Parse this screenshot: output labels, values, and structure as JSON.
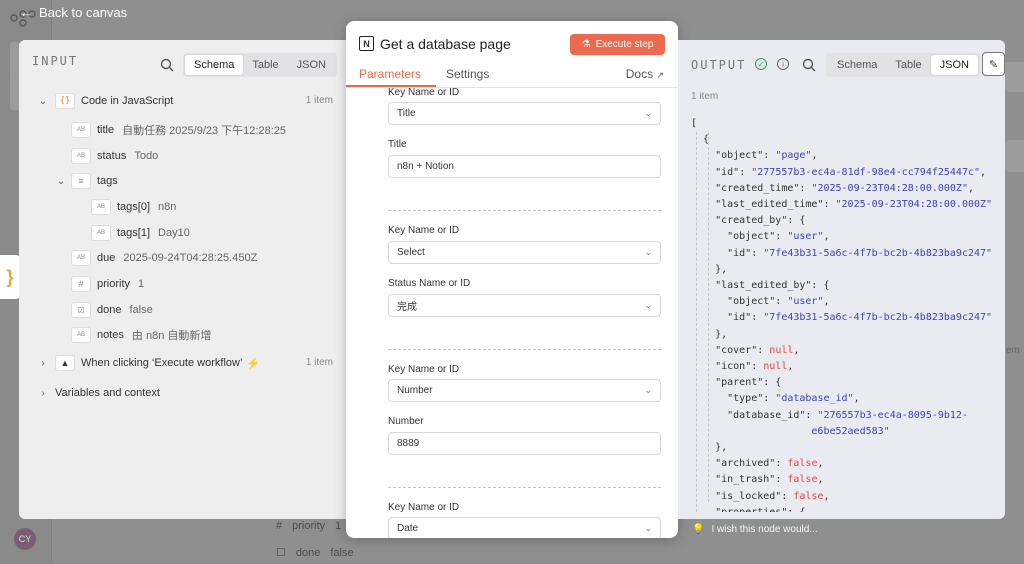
{
  "nav": {
    "back_label": "Back to canvas"
  },
  "bg": {
    "priority_key": "priority",
    "priority_val": "1",
    "done_key": "done",
    "done_val": "false",
    "right_frag": "em",
    "avatar_initials": "CY"
  },
  "input": {
    "header": "INPUT",
    "views": [
      "Schema",
      "Table",
      "JSON"
    ],
    "active_view": "Schema",
    "node_name": "Code in JavaScript",
    "node_count": "1 item",
    "fields": [
      {
        "type": "AB",
        "key": "title",
        "value": "自動任務 2025/9/23 下午12:28:25"
      },
      {
        "type": "AB",
        "key": "status",
        "value": "Todo"
      },
      {
        "type": "≡",
        "key": "tags",
        "value": ""
      },
      {
        "type": "AB",
        "key": "tags[0]",
        "value": "n8n"
      },
      {
        "type": "AB",
        "key": "tags[1]",
        "value": "Day10"
      },
      {
        "type": "AB",
        "key": "due",
        "value": "2025-09-24T04:28:25.450Z"
      },
      {
        "type": "#",
        "key": "priority",
        "value": "1"
      },
      {
        "type": "☑",
        "key": "done",
        "value": "false"
      },
      {
        "type": "AB",
        "key": "notes",
        "value": "由 n8n 自動新增"
      }
    ],
    "trigger_name": "When clicking ‘Execute workflow’",
    "trigger_count": "1 item",
    "vars_label": "Variables and context"
  },
  "modal": {
    "title": "Get a database page",
    "execute_label": "Execute step",
    "tabs": [
      "Parameters",
      "Settings"
    ],
    "docs_label": "Docs",
    "groups": [
      {
        "key_label": "Key Name or ID",
        "key_value": "Title",
        "field_label": "Title",
        "field_value": "n8n + Notion",
        "field_kind": "input"
      },
      {
        "key_label": "Key Name or ID",
        "key_value": "Select",
        "field_label": "Status Name or ID",
        "field_value": "完成",
        "field_kind": "select"
      },
      {
        "key_label": "Key Name or ID",
        "key_value": "Number",
        "field_label": "Number",
        "field_value": "8889",
        "field_kind": "input"
      },
      {
        "key_label": "Key Name or ID",
        "key_value": "Date"
      }
    ]
  },
  "output": {
    "header": "OUTPUT",
    "views": [
      "Schema",
      "Table",
      "JSON"
    ],
    "active_view": "JSON",
    "count": "1 item",
    "json_lines": [
      [
        [
          "p",
          "["
        ]
      ],
      [
        [
          "p",
          "  {"
        ]
      ],
      [
        [
          "p",
          "    "
        ],
        [
          "k",
          "\"object\""
        ],
        [
          "p",
          ": "
        ],
        [
          "s",
          "\"page\""
        ],
        [
          "p",
          ","
        ]
      ],
      [
        [
          "p",
          "    "
        ],
        [
          "k",
          "\"id\""
        ],
        [
          "p",
          ": "
        ],
        [
          "s",
          "\"277557b3-ec4a-81df-98e4-cc794f25447c\""
        ],
        [
          "p",
          ","
        ]
      ],
      [
        [
          "p",
          "    "
        ],
        [
          "k",
          "\"created_time\""
        ],
        [
          "p",
          ": "
        ],
        [
          "s",
          "\"2025-09-23T04:28:00.000Z\""
        ],
        [
          "p",
          ","
        ]
      ],
      [
        [
          "p",
          "    "
        ],
        [
          "k",
          "\"last_edited_time\""
        ],
        [
          "p",
          ": "
        ],
        [
          "s",
          "\"2025-09-23T04:28:00.000Z\""
        ],
        [
          "p",
          ","
        ]
      ],
      [
        [
          "p",
          "    "
        ],
        [
          "k",
          "\"created_by\""
        ],
        [
          "p",
          ": {"
        ]
      ],
      [
        [
          "p",
          "      "
        ],
        [
          "k",
          "\"object\""
        ],
        [
          "p",
          ": "
        ],
        [
          "s",
          "\"user\""
        ],
        [
          "p",
          ","
        ]
      ],
      [
        [
          "p",
          "      "
        ],
        [
          "k",
          "\"id\""
        ],
        [
          "p",
          ": "
        ],
        [
          "s",
          "\"7fe43b31-5a6c-4f7b-bc2b-4b823ba9c247\""
        ]
      ],
      [
        [
          "p",
          "    },"
        ]
      ],
      [
        [
          "p",
          "    "
        ],
        [
          "k",
          "\"last_edited_by\""
        ],
        [
          "p",
          ": {"
        ]
      ],
      [
        [
          "p",
          "      "
        ],
        [
          "k",
          "\"object\""
        ],
        [
          "p",
          ": "
        ],
        [
          "s",
          "\"user\""
        ],
        [
          "p",
          ","
        ]
      ],
      [
        [
          "p",
          "      "
        ],
        [
          "k",
          "\"id\""
        ],
        [
          "p",
          ": "
        ],
        [
          "s",
          "\"7fe43b31-5a6c-4f7b-bc2b-4b823ba9c247\""
        ]
      ],
      [
        [
          "p",
          "    },"
        ]
      ],
      [
        [
          "p",
          "    "
        ],
        [
          "k",
          "\"cover\""
        ],
        [
          "p",
          ": "
        ],
        [
          "n",
          "null"
        ],
        [
          "p",
          ","
        ]
      ],
      [
        [
          "p",
          "    "
        ],
        [
          "k",
          "\"icon\""
        ],
        [
          "p",
          ": "
        ],
        [
          "n",
          "null"
        ],
        [
          "p",
          ","
        ]
      ],
      [
        [
          "p",
          "    "
        ],
        [
          "k",
          "\"parent\""
        ],
        [
          "p",
          ": {"
        ]
      ],
      [
        [
          "p",
          "      "
        ],
        [
          "k",
          "\"type\""
        ],
        [
          "p",
          ": "
        ],
        [
          "s",
          "\"database_id\""
        ],
        [
          "p",
          ","
        ]
      ],
      [
        [
          "p",
          "      "
        ],
        [
          "k",
          "\"database_id\""
        ],
        [
          "p",
          ": "
        ],
        [
          "s",
          "\"276557b3-ec4a-8095-9b12-"
        ]
      ],
      [
        [
          "s",
          "                    e6be52aed583\""
        ]
      ],
      [
        [
          "p",
          "    },"
        ]
      ],
      [
        [
          "p",
          "    "
        ],
        [
          "k",
          "\"archived\""
        ],
        [
          "p",
          ": "
        ],
        [
          "n",
          "false"
        ],
        [
          "p",
          ","
        ]
      ],
      [
        [
          "p",
          "    "
        ],
        [
          "k",
          "\"in_trash\""
        ],
        [
          "p",
          ": "
        ],
        [
          "n",
          "false"
        ],
        [
          "p",
          ","
        ]
      ],
      [
        [
          "p",
          "    "
        ],
        [
          "k",
          "\"is_locked\""
        ],
        [
          "p",
          ": "
        ],
        [
          "n",
          "false"
        ],
        [
          "p",
          ","
        ]
      ],
      [
        [
          "p",
          "    "
        ],
        [
          "k",
          "\"properties\""
        ],
        [
          "p",
          ": {"
        ]
      ]
    ]
  },
  "footer": {
    "wish_label": "I wish this node would..."
  },
  "colors": {
    "accent": "#e96a48",
    "execute": "#ec6a4f",
    "json_string": "#3d43b8",
    "json_literal": "#e5484d",
    "ok": "#2f9e5a"
  }
}
